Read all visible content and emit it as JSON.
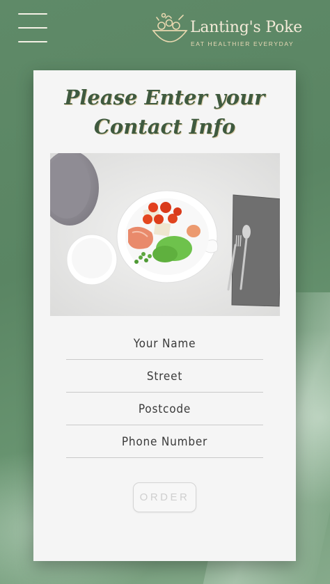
{
  "header": {
    "menu_icon": "hamburger-menu-icon",
    "logo_icon": "salad-bowl-icon",
    "brand_name": "Lanting's Poke",
    "tagline": "EAT HEALTHIER EVERYDAY"
  },
  "form": {
    "title_line1": "Please Enter your",
    "title_line2": "Contact Info",
    "image_alt": "poke-bowl-plate-photo",
    "fields": [
      {
        "placeholder": "Your Name",
        "value": ""
      },
      {
        "placeholder": "Street",
        "value": ""
      },
      {
        "placeholder": "Postcode",
        "value": ""
      },
      {
        "placeholder": "Phone Number",
        "value": ""
      }
    ],
    "order_label": "ORDER"
  },
  "colors": {
    "background_green": "#5f8a68",
    "title_green": "#3f5a3f",
    "logo_cream": "#f3ead8",
    "card": "#f5f5f5"
  }
}
